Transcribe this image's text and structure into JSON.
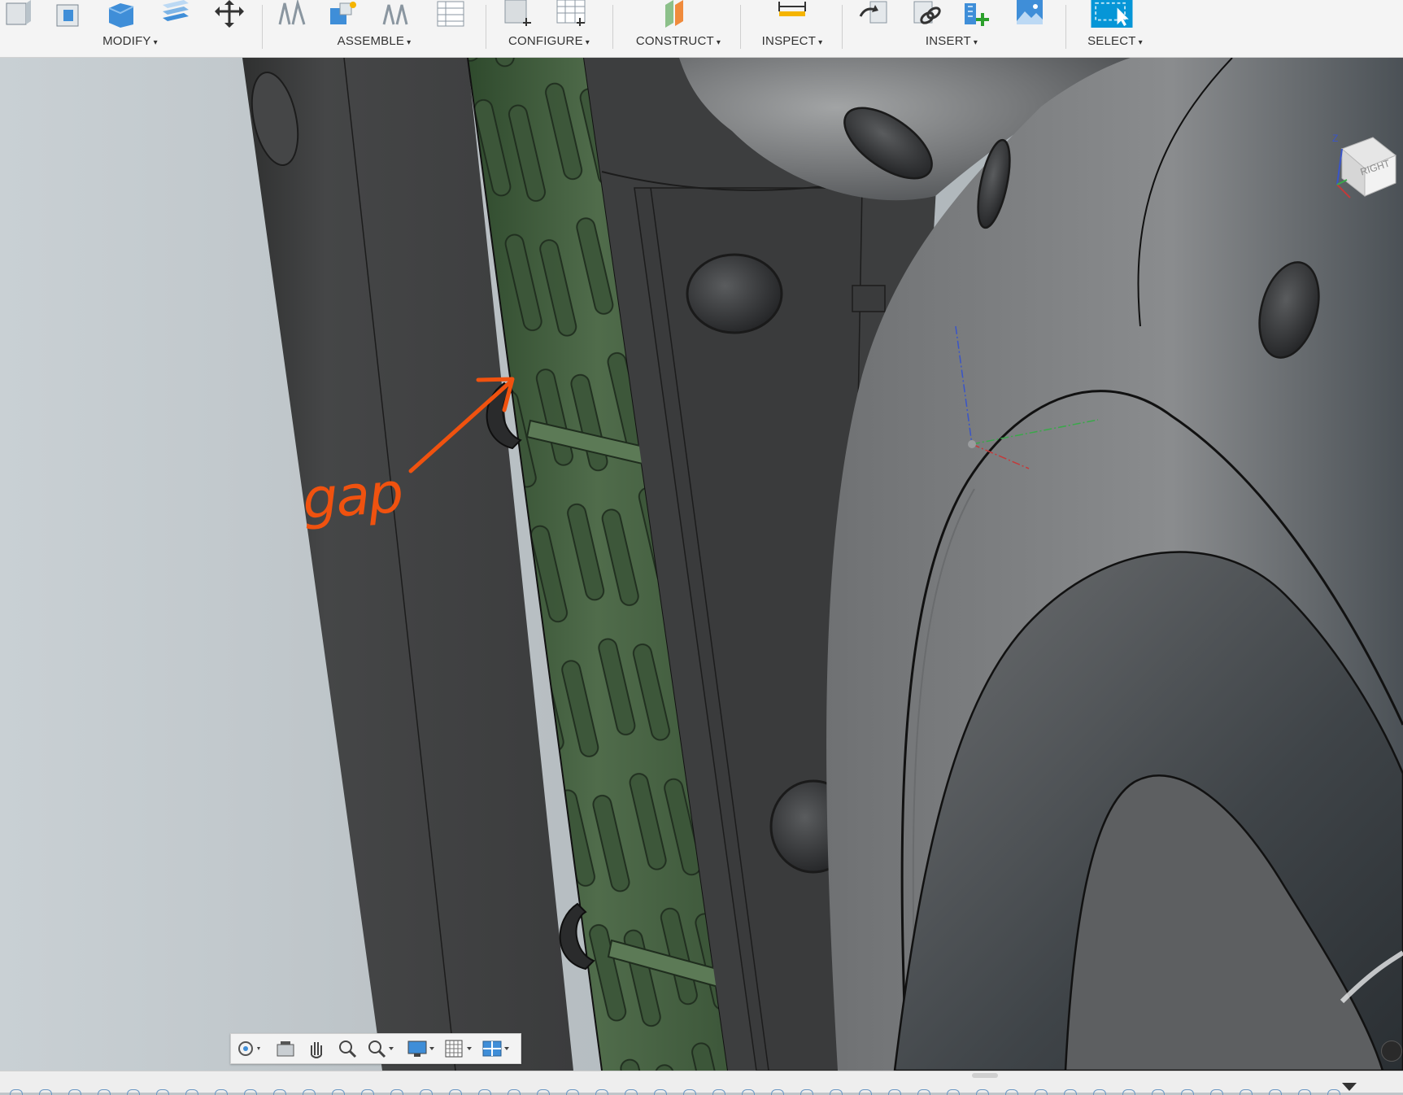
{
  "toolbar": {
    "groups": [
      {
        "id": "modify",
        "label": "MODIFY"
      },
      {
        "id": "assemble",
        "label": "ASSEMBLE"
      },
      {
        "id": "configure",
        "label": "CONFIGURE"
      },
      {
        "id": "construct",
        "label": "CONSTRUCT"
      },
      {
        "id": "inspect",
        "label": "INSPECT"
      },
      {
        "id": "insert",
        "label": "INSERT"
      },
      {
        "id": "select",
        "label": "SELECT"
      }
    ],
    "caret": "▾"
  },
  "viewport": {
    "annotation_text": "gap",
    "annotation_color": "#f0520f",
    "viewcube_face": "RIGHT",
    "axis_z_label": "Z",
    "highlight_color": "#4f6b4a"
  },
  "navbar": {
    "icons": [
      "orbit-icon",
      "look-at-icon",
      "pan-icon",
      "zoom-icon",
      "fit-icon",
      "display-settings-icon",
      "grid-settings-icon",
      "viewports-icon"
    ]
  }
}
